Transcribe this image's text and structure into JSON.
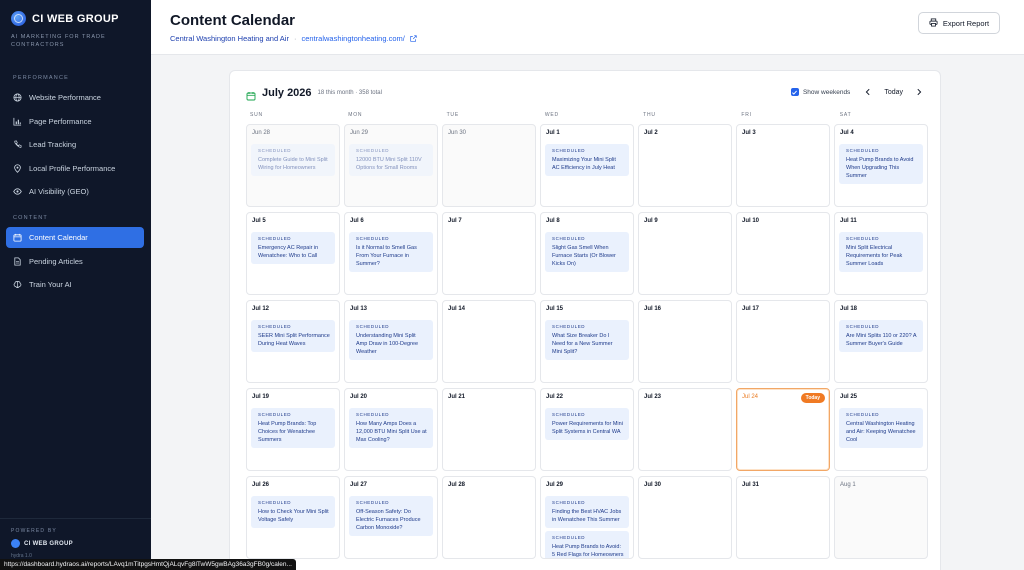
{
  "brand": {
    "name": "CI WEB GROUP",
    "tagline": "AI MARKETING FOR TRADE CONTRACTORS"
  },
  "sidebar": {
    "sections": [
      {
        "label": "PERFORMANCE",
        "items": [
          {
            "label": "Website Performance",
            "icon": "globe-icon"
          },
          {
            "label": "Page Performance",
            "icon": "bar-chart-icon"
          },
          {
            "label": "Lead Tracking",
            "icon": "phone-icon"
          },
          {
            "label": "Local Profile Performance",
            "icon": "map-pin-icon"
          },
          {
            "label": "AI Visibility (GEO)",
            "icon": "eye-icon"
          }
        ]
      },
      {
        "label": "CONTENT",
        "items": [
          {
            "label": "Content Calendar",
            "icon": "calendar-icon",
            "active": true
          },
          {
            "label": "Pending Articles",
            "icon": "document-icon"
          },
          {
            "label": "Train Your AI",
            "icon": "brain-icon"
          }
        ]
      }
    ],
    "powered_by": "POWERED BY",
    "powered_brand": "CI WEB GROUP",
    "version": "hydra 1.0"
  },
  "header": {
    "title": "Content Calendar",
    "client": "Central Washington Heating and Air",
    "separator": "·",
    "domain": "centralwashingtonheating.com/",
    "export_label": "Export Report"
  },
  "calendar": {
    "month_label": "July 2026",
    "count_label": "18 this month · 358 total",
    "show_weekends_label": "Show weekends",
    "show_weekends": true,
    "today_label": "Today",
    "today_badge": "Today",
    "weekdays": [
      "SUN",
      "MON",
      "TUE",
      "WED",
      "THU",
      "FRI",
      "SAT"
    ],
    "days": [
      {
        "date": "Jun 28",
        "out": true,
        "events": [
          {
            "status": "SCHEDULED",
            "title": "Complete Guide to Mini Split Wiring for Homeowners"
          }
        ]
      },
      {
        "date": "Jun 29",
        "out": true,
        "events": [
          {
            "status": "SCHEDULED",
            "title": "12000 BTU Mini Split 110V Options for Small Rooms"
          }
        ]
      },
      {
        "date": "Jun 30",
        "out": true,
        "events": []
      },
      {
        "date": "Jul 1",
        "events": [
          {
            "status": "SCHEDULED",
            "title": "Maximizing Your Mini Split AC Efficiency in July Heat"
          }
        ]
      },
      {
        "date": "Jul 2",
        "events": []
      },
      {
        "date": "Jul 3",
        "events": []
      },
      {
        "date": "Jul 4",
        "events": [
          {
            "status": "SCHEDULED",
            "title": "Heat Pump Brands to Avoid When Upgrading This Summer"
          }
        ]
      },
      {
        "date": "Jul 5",
        "events": [
          {
            "status": "SCHEDULED",
            "title": "Emergency AC Repair in Wenatchee: Who to Call"
          }
        ]
      },
      {
        "date": "Jul 6",
        "events": [
          {
            "status": "SCHEDULED",
            "title": "Is it Normal to Smell Gas From Your Furnace in Summer?"
          }
        ]
      },
      {
        "date": "Jul 7",
        "events": []
      },
      {
        "date": "Jul 8",
        "events": [
          {
            "status": "SCHEDULED",
            "title": "Slight Gas Smell When Furnace Starts (Or Blower Kicks On)"
          }
        ]
      },
      {
        "date": "Jul 9",
        "events": []
      },
      {
        "date": "Jul 10",
        "events": []
      },
      {
        "date": "Jul 11",
        "events": [
          {
            "status": "SCHEDULED",
            "title": "Mini Split Electrical Requirements for Peak Summer Loads"
          }
        ]
      },
      {
        "date": "Jul 12",
        "events": [
          {
            "status": "SCHEDULED",
            "title": "SEER Mini Split Performance During Heat Waves"
          }
        ]
      },
      {
        "date": "Jul 13",
        "events": [
          {
            "status": "SCHEDULED",
            "title": "Understanding Mini Split Amp Draw in 100-Degree Weather"
          }
        ]
      },
      {
        "date": "Jul 14",
        "events": []
      },
      {
        "date": "Jul 15",
        "events": [
          {
            "status": "SCHEDULED",
            "title": "What Size Breaker Do I Need for a New Summer Mini Split?"
          }
        ]
      },
      {
        "date": "Jul 16",
        "events": []
      },
      {
        "date": "Jul 17",
        "events": []
      },
      {
        "date": "Jul 18",
        "events": [
          {
            "status": "SCHEDULED",
            "title": "Are Mini Splits 110 or 220? A Summer Buyer's Guide"
          }
        ]
      },
      {
        "date": "Jul 19",
        "events": [
          {
            "status": "SCHEDULED",
            "title": "Heat Pump Brands: Top Choices for Wenatchee Summers"
          }
        ]
      },
      {
        "date": "Jul 20",
        "events": [
          {
            "status": "SCHEDULED",
            "title": "How Many Amps Does a 12,000 BTU Mini Split Use at Max Cooling?"
          }
        ]
      },
      {
        "date": "Jul 21",
        "events": []
      },
      {
        "date": "Jul 22",
        "events": [
          {
            "status": "SCHEDULED",
            "title": "Power Requirements for Mini Split Systems in Central WA"
          }
        ]
      },
      {
        "date": "Jul 23",
        "events": []
      },
      {
        "date": "Jul 24",
        "today": true,
        "events": []
      },
      {
        "date": "Jul 25",
        "events": [
          {
            "status": "SCHEDULED",
            "title": "Central Washington Heating and Air: Keeping Wenatchee Cool"
          }
        ]
      },
      {
        "date": "Jul 26",
        "events": [
          {
            "status": "SCHEDULED",
            "title": "How to Check Your Mini Split Voltage Safely"
          }
        ]
      },
      {
        "date": "Jul 27",
        "events": [
          {
            "status": "SCHEDULED",
            "title": "Off-Season Safety: Do Electric Furnaces Produce Carbon Monoxide?"
          }
        ]
      },
      {
        "date": "Jul 28",
        "events": []
      },
      {
        "date": "Jul 29",
        "events": [
          {
            "status": "SCHEDULED",
            "title": "Finding the Best HVAC Jobs in Wenatchee This Summer"
          },
          {
            "status": "SCHEDULED",
            "title": "Heat Pump Brands to Avoid: 5 Red Flags for Homeowners"
          }
        ]
      },
      {
        "date": "Jul 30",
        "events": []
      },
      {
        "date": "Jul 31",
        "events": []
      },
      {
        "date": "Aug 1",
        "out": true,
        "events": []
      }
    ]
  },
  "statusbar": {
    "url": "https://dashboard.hydraos.ai/reports/LAvq1mTitpgsHmtQjALqvFg8lTwW5gwBAg36a3gFB0g/calen..."
  },
  "colors": {
    "sidebar_bg": "#0f1729",
    "accent": "#2f6fe4",
    "today": "#f07a23",
    "event_bg": "#eaf1fd"
  }
}
